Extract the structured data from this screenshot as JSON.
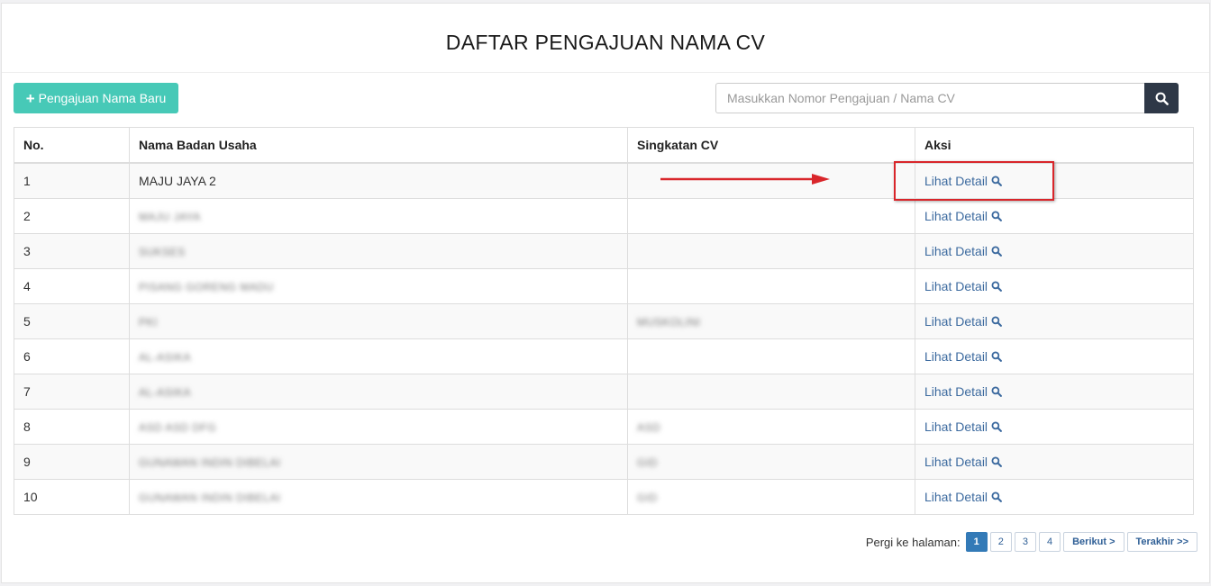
{
  "page": {
    "title": "DAFTAR PENGAJUAN NAMA CV"
  },
  "toolbar": {
    "new_button_label": "Pengajuan Nama Baru",
    "search_placeholder": "Masukkan Nomor Pengajuan / Nama CV",
    "search_value": ""
  },
  "table": {
    "headers": {
      "no": "No.",
      "name": "Nama Badan Usaha",
      "abbr": "Singkatan CV",
      "action": "Aksi"
    },
    "rows": [
      {
        "no": "1",
        "name": "MAJU JAYA 2",
        "abbr": "",
        "action": "Lihat Detail",
        "blurred": false
      },
      {
        "no": "2",
        "name": "MAJU JAYA",
        "abbr": "",
        "action": "Lihat Detail",
        "blurred": true
      },
      {
        "no": "3",
        "name": "SUKSES",
        "abbr": "",
        "action": "Lihat Detail",
        "blurred": true
      },
      {
        "no": "4",
        "name": "PISANG GORENG MADU",
        "abbr": "",
        "action": "Lihat Detail",
        "blurred": true
      },
      {
        "no": "5",
        "name": "PKI",
        "abbr": "MUSKOLINI",
        "action": "Lihat Detail",
        "blurred": true
      },
      {
        "no": "6",
        "name": "AL-ASIKA",
        "abbr": "",
        "action": "Lihat Detail",
        "blurred": true
      },
      {
        "no": "7",
        "name": "AL-ASIKA",
        "abbr": "",
        "action": "Lihat Detail",
        "blurred": true
      },
      {
        "no": "8",
        "name": "ASD ASD DFG",
        "abbr": "ASD",
        "action": "Lihat Detail",
        "blurred": true
      },
      {
        "no": "9",
        "name": "GUNAWAN INDIN DIBELAI",
        "abbr": "GID",
        "action": "Lihat Detail",
        "blurred": true
      },
      {
        "no": "10",
        "name": "GUNAWAN INDIN DIBELAI",
        "abbr": "GID",
        "action": "Lihat Detail",
        "blurred": true
      }
    ]
  },
  "pagination": {
    "label": "Pergi ke halaman:",
    "pages": [
      "1",
      "2",
      "3",
      "4"
    ],
    "active_page": "1",
    "next_label": "Berikut >",
    "last_label": "Terakhir >>"
  },
  "icons": {
    "new": "plus-icon",
    "search": "search-icon",
    "detail": "magnifier-icon"
  },
  "colors": {
    "primary_button": "#47c9b7",
    "search_button": "#2e3847",
    "link": "#3c6a9f",
    "pagination_active": "#337ab7",
    "annotation": "#d9262b"
  }
}
